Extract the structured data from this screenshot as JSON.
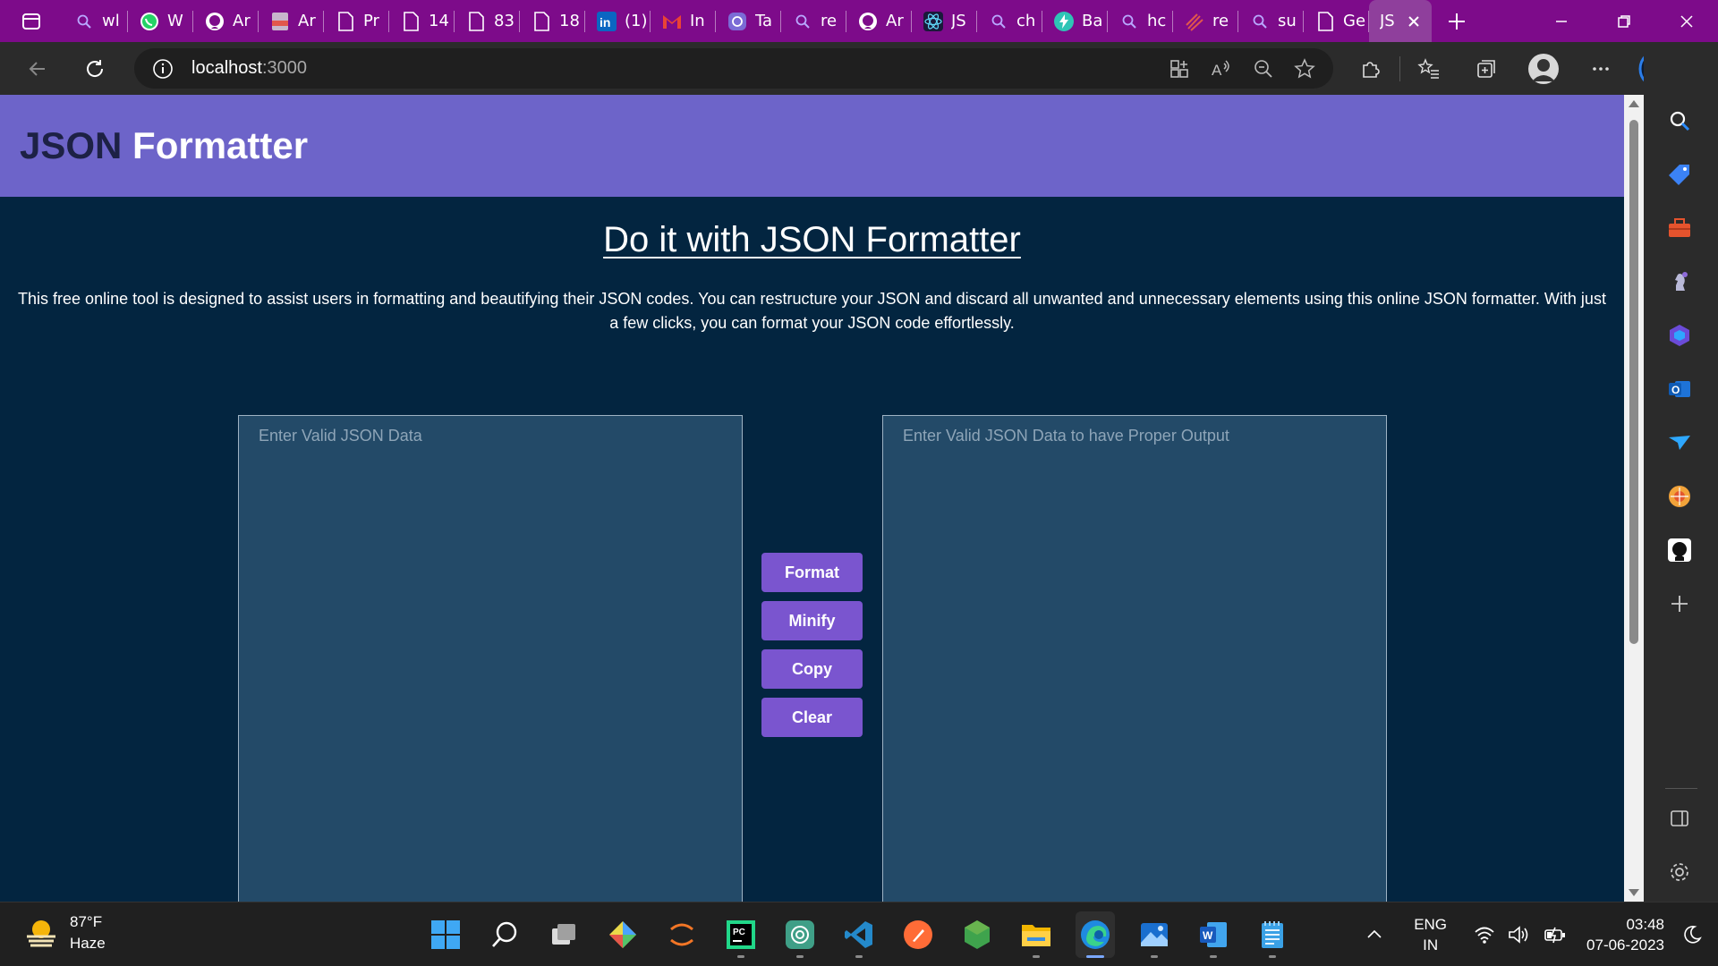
{
  "browser": {
    "tabs": [
      {
        "icon": "search-icon",
        "title": "wl"
      },
      {
        "icon": "whatsapp-icon",
        "title": "W"
      },
      {
        "icon": "github-icon",
        "title": "Ar"
      },
      {
        "icon": "pdf-icon",
        "title": "Ar"
      },
      {
        "icon": "page-icon",
        "title": "Pr"
      },
      {
        "icon": "page-icon",
        "title": "14"
      },
      {
        "icon": "page-icon",
        "title": "83"
      },
      {
        "icon": "page-icon",
        "title": "18"
      },
      {
        "icon": "linkedin-icon",
        "title": "(1)"
      },
      {
        "icon": "gmail-icon",
        "title": "In"
      },
      {
        "icon": "app-icon",
        "title": "Ta"
      },
      {
        "icon": "search-icon",
        "title": "re"
      },
      {
        "icon": "github-icon",
        "title": "Ar"
      },
      {
        "icon": "react-icon",
        "title": "JS"
      },
      {
        "icon": "search-icon",
        "title": "ch"
      },
      {
        "icon": "bolt-icon",
        "title": "Ba"
      },
      {
        "icon": "search-icon",
        "title": "hc"
      },
      {
        "icon": "fire-icon",
        "title": "re"
      },
      {
        "icon": "search-icon",
        "title": "su"
      },
      {
        "icon": "page-icon",
        "title": "Ge"
      }
    ],
    "active_tab": {
      "title": "JS"
    },
    "address": {
      "host": "localhost",
      "port": ":3000"
    }
  },
  "app": {
    "title_dark": "JSON",
    "title_light": " Formatter",
    "hero_title": "Do it with JSON Formatter",
    "description": "This free online tool is designed to assist users in formatting and beautifying their JSON codes. You can restructure your JSON and discard all unwanted and unnecessary elements using this online JSON formatter. With just a few clicks, you can format your JSON code effortlessly.",
    "input_placeholder": "Enter Valid JSON Data",
    "output_placeholder": "Enter Valid JSON Data to have Proper Output",
    "buttons": {
      "format": "Format",
      "minify": "Minify",
      "copy": "Copy",
      "clear": "Clear"
    }
  },
  "taskbar": {
    "weather": {
      "temp": "87°F",
      "condition": "Haze"
    },
    "lang": {
      "line1": "ENG",
      "line2": "IN"
    },
    "clock": {
      "time": "03:48",
      "date": "07-06-2023"
    }
  },
  "colors": {
    "tab_strip": "#7d0b8a",
    "app_header": "#6d64c9",
    "page_bg": "#032540",
    "editor_bg": "#234a68",
    "button": "#7a55cf"
  }
}
